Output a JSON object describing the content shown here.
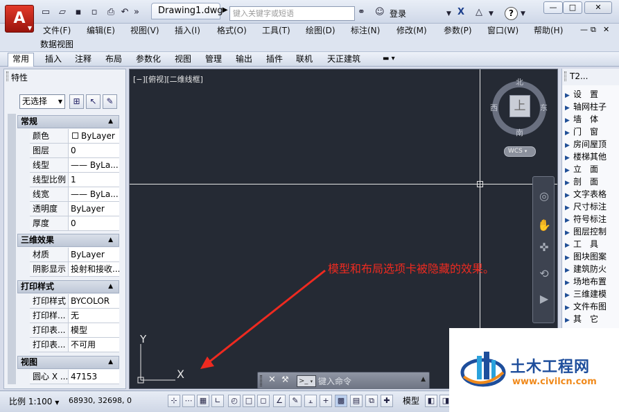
{
  "titlebar": {
    "document_name": "Drawing1.dwg",
    "search_placeholder": "键入关键字或短语",
    "login_label": "登录",
    "help_label": "?",
    "window_buttons": [
      "—",
      "□",
      "✕"
    ]
  },
  "menubar": {
    "items": [
      "文件(F)",
      "编辑(E)",
      "视图(V)",
      "插入(I)",
      "格式(O)",
      "工具(T)",
      "绘图(D)",
      "标注(N)",
      "修改(M)",
      "参数(P)",
      "窗口(W)",
      "帮助(H)"
    ],
    "second_row": "数据视图",
    "mdi_buttons": [
      "—",
      "⧉",
      "✕"
    ]
  },
  "ribbon": {
    "tabs": [
      "常用",
      "插入",
      "注释",
      "布局",
      "参数化",
      "视图",
      "管理",
      "输出",
      "插件",
      "联机",
      "天正建筑"
    ],
    "active_tab": "常用"
  },
  "properties": {
    "title": "特性",
    "selection": "无选择",
    "sections": [
      {
        "name": "常规",
        "rows": [
          {
            "key": "颜色",
            "value": "ByLayer"
          },
          {
            "key": "图层",
            "value": "0"
          },
          {
            "key": "线型",
            "value": "—— ByLa..."
          },
          {
            "key": "线型比例",
            "value": "1"
          },
          {
            "key": "线宽",
            "value": "—— ByLa..."
          },
          {
            "key": "透明度",
            "value": "ByLayer"
          },
          {
            "key": "厚度",
            "value": "0"
          }
        ]
      },
      {
        "name": "三维效果",
        "rows": [
          {
            "key": "材质",
            "value": "ByLayer"
          },
          {
            "key": "阴影显示",
            "value": "投射和接收..."
          }
        ]
      },
      {
        "name": "打印样式",
        "rows": [
          {
            "key": "打印样式",
            "value": "BYCOLOR"
          },
          {
            "key": "打印样...",
            "value": "无"
          },
          {
            "key": "打印表...",
            "value": "模型"
          },
          {
            "key": "打印表...",
            "value": "不可用"
          }
        ]
      },
      {
        "name": "视图",
        "rows": [
          {
            "key": "圆心 X ...",
            "value": "47153"
          }
        ]
      }
    ]
  },
  "canvas": {
    "viewport_label": "[−][俯视][二维线框]",
    "compass": {
      "north": "北",
      "south": "南",
      "east": "东",
      "west": "西",
      "face": "上"
    },
    "wcs_label": "WCS",
    "annotation": "模型和布局选项卡被隐藏的效果。",
    "annotation_color": "#ee2a20",
    "ucs": {
      "x": "X",
      "y": "Y"
    },
    "command_placeholder": "键入命令",
    "command_prompt": ">_"
  },
  "tool_palette": {
    "title": "T2...",
    "items": [
      "设　置",
      "轴网柱子",
      "墙　体",
      "门　窗",
      "房间屋顶",
      "楼梯其他",
      "立　面",
      "剖　面",
      "文字表格",
      "尺寸标注",
      "符号标注",
      "图层控制",
      "工　具",
      "图块图案",
      "建筑防火",
      "场地布置",
      "三维建模",
      "文件布图",
      "其　它"
    ]
  },
  "statusbar": {
    "scale_label": "比例 1:100",
    "coordinates": "68930, 32698, 0",
    "model_label": "模型"
  },
  "watermark": {
    "name": "土木工程网",
    "url": "www.civilcn.com"
  }
}
